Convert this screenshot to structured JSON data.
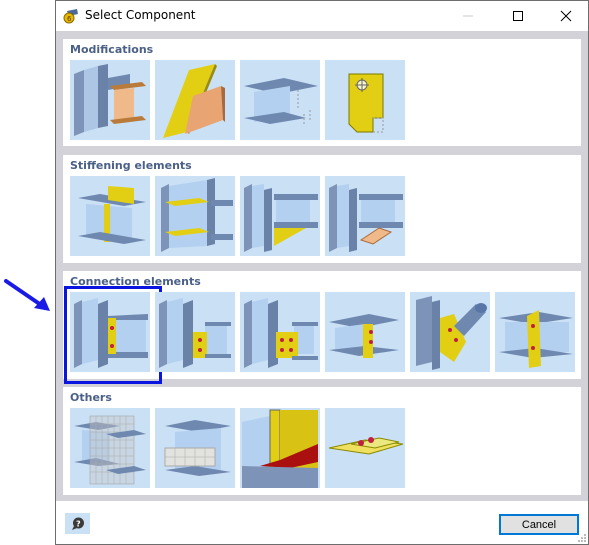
{
  "window": {
    "title": "Select Component",
    "app_icon": "rfem-connection-icon",
    "controls": [
      "minimize",
      "maximize",
      "close"
    ]
  },
  "groups": [
    {
      "title": "Modifications",
      "items": [
        {
          "name": "beam-end-shortening",
          "icon": "column-beam-orange-icon"
        },
        {
          "name": "inclined-cut",
          "icon": "inclined-plate-cut-icon"
        },
        {
          "name": "flange-cut",
          "icon": "notched-beam-icon"
        },
        {
          "name": "plate-cut",
          "icon": "yellow-plate-hole-icon"
        }
      ]
    },
    {
      "title": "Stiffening elements",
      "items": [
        {
          "name": "web-stiffener",
          "icon": "web-stiffener-icon"
        },
        {
          "name": "column-stiffeners",
          "icon": "column-stiffeners-icon"
        },
        {
          "name": "haunch-plate",
          "icon": "haunch-plate-icon"
        },
        {
          "name": "haunch-section",
          "icon": "haunch-section-icon"
        }
      ]
    },
    {
      "title": "Connection elements",
      "selected_index": 0,
      "items": [
        {
          "name": "fin-plate",
          "icon": "fin-plate-icon"
        },
        {
          "name": "end-plate-small",
          "icon": "end-plate-two-bolts-icon"
        },
        {
          "name": "end-plate-four-bolts",
          "icon": "end-plate-four-bolts-icon"
        },
        {
          "name": "beam-to-beam-fin-plate",
          "icon": "beam-fin-plate-icon"
        },
        {
          "name": "tube-gusset",
          "icon": "tube-gusset-icon"
        },
        {
          "name": "splice-plate",
          "icon": "splice-plate-icon"
        }
      ]
    },
    {
      "title": "Others",
      "items": [
        {
          "name": "fe-mesh",
          "icon": "mesh-plane-icon"
        },
        {
          "name": "auxiliary-block",
          "icon": "auxiliary-block-icon"
        },
        {
          "name": "weld",
          "icon": "weld-icon"
        },
        {
          "name": "bolt-plate-assembly",
          "icon": "bolt-plate-icon"
        }
      ]
    }
  ],
  "footer": {
    "help_icon": "help-icon",
    "cancel_label": "Cancel"
  },
  "colors": {
    "accent": "#0078d7",
    "selection": "#0a16e0",
    "group_title": "#4a6088",
    "thumb_bg": "#c9e0f5",
    "panel_bg": "#d2d2d8"
  }
}
